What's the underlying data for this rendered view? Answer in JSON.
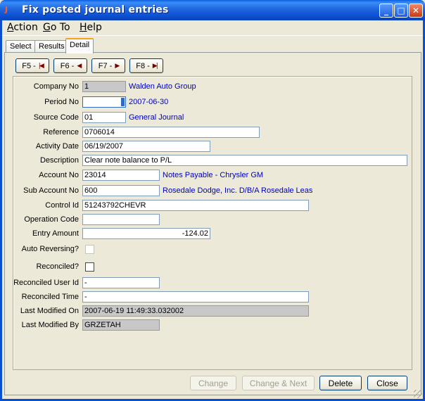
{
  "window": {
    "title": "Fix posted journal entries",
    "app_icon": "J",
    "minimize": "_",
    "maximize": "□",
    "close": "✕"
  },
  "menu": [
    "Action",
    "Go To",
    "Help"
  ],
  "tabs": [
    {
      "label": "Select",
      "active": false
    },
    {
      "label": "Results",
      "active": false
    },
    {
      "label": "Detail",
      "active": true
    }
  ],
  "nav": [
    {
      "label": "F5 -",
      "icon": "first-record-icon",
      "glyph": "|◀"
    },
    {
      "label": "F6 -",
      "icon": "previous-record-icon",
      "glyph": "◀"
    },
    {
      "label": "F7 -",
      "icon": "next-record-icon",
      "glyph": "▶"
    },
    {
      "label": "F8 -",
      "icon": "last-record-icon",
      "glyph": "▶|"
    }
  ],
  "form": {
    "company_no": {
      "label": "Company No",
      "value": "1",
      "desc": "Walden Auto Group"
    },
    "period_no": {
      "label": "Period No",
      "value": "",
      "desc": "2007-06-30"
    },
    "source_code": {
      "label": "Source Code",
      "value": "01",
      "desc": "General Journal"
    },
    "reference": {
      "label": "Reference",
      "value": "0706014"
    },
    "activity_date": {
      "label": "Activity Date",
      "value": "06/19/2007"
    },
    "description": {
      "label": "Description",
      "value": "Clear note balance to P/L"
    },
    "account_no": {
      "label": "Account No",
      "value": "23014",
      "desc": "Notes Payable - Chrysler GM"
    },
    "sub_account_no": {
      "label": "Sub Account No",
      "value": "600",
      "desc": "Rosedale Dodge, Inc. D/B/A Rosedale Leas"
    },
    "control_id": {
      "label": "Control Id",
      "value": "51243792CHEVR"
    },
    "operation_code": {
      "label": "Operation Code",
      "value": ""
    },
    "entry_amount": {
      "label": "Entry Amount",
      "value": "-124.02"
    },
    "auto_reversing": {
      "label": "Auto Reversing?",
      "checked": false
    },
    "reconciled": {
      "label": "Reconciled?",
      "checked": false
    },
    "reconciled_user_id": {
      "label": "Reconciled User Id",
      "value": "-"
    },
    "reconciled_time": {
      "label": "Reconciled Time",
      "value": "-"
    },
    "last_modified_on": {
      "label": "Last Modified On",
      "value": "2007-06-19 11:49:33.032002"
    },
    "last_modified_by": {
      "label": "Last Modified By",
      "value": "GRZETAH"
    }
  },
  "buttons": {
    "change": "Change",
    "change_next": "Change & Next",
    "delete": "Delete",
    "close": "Close"
  }
}
